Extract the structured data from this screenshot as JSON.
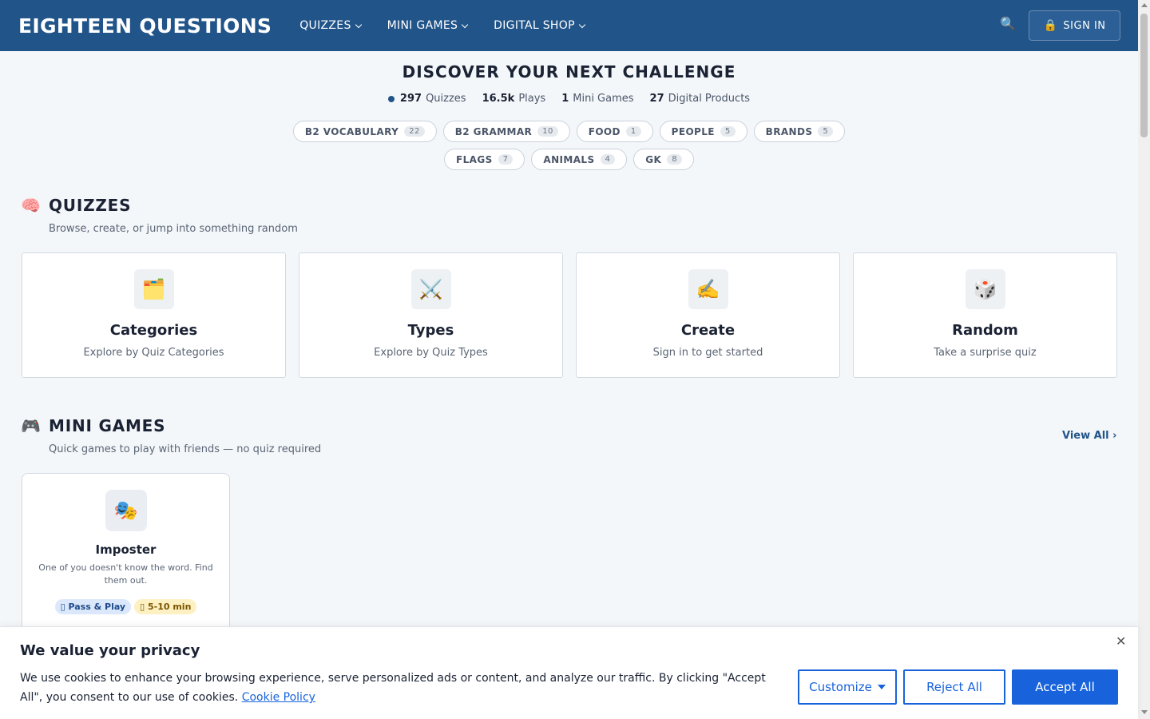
{
  "header": {
    "brand": "EIGHTEEN QUESTIONS",
    "nav": [
      {
        "label": "QUIZZES"
      },
      {
        "label": "MINI GAMES"
      },
      {
        "label": "DIGITAL SHOP"
      }
    ],
    "search_icon": "🔍",
    "signin_icon": "🔒",
    "signin_label": "SIGN IN"
  },
  "hero": {
    "title": "DISCOVER YOUR NEXT CHALLENGE",
    "stats": [
      {
        "value": "297",
        "label": "Quizzes"
      },
      {
        "value": "16.5k",
        "label": "Plays"
      },
      {
        "value": "1",
        "label": "Mini Games"
      },
      {
        "value": "27",
        "label": "Digital Products"
      }
    ],
    "chips": [
      {
        "label": "B2 VOCABULARY",
        "count": "22"
      },
      {
        "label": "B2 GRAMMAR",
        "count": "10"
      },
      {
        "label": "FOOD",
        "count": "1"
      },
      {
        "label": "PEOPLE",
        "count": "5"
      },
      {
        "label": "BRANDS",
        "count": "5"
      },
      {
        "label": "FLAGS",
        "count": "7"
      },
      {
        "label": "ANIMALS",
        "count": "4"
      },
      {
        "label": "GK",
        "count": "8"
      }
    ]
  },
  "quizzes": {
    "icon": "🧠",
    "title": "QUIZZES",
    "subtitle": "Browse, create, or jump into something random",
    "cards": [
      {
        "icon": "🗂️",
        "title": "Categories",
        "desc": "Explore by Quiz Categories"
      },
      {
        "icon": "⚔️",
        "title": "Types",
        "desc": "Explore by Quiz Types"
      },
      {
        "icon": "✍️",
        "title": "Create",
        "desc": "Sign in to get started"
      },
      {
        "icon": "🎲",
        "title": "Random",
        "desc": "Take a surprise quiz"
      }
    ]
  },
  "mini_games": {
    "icon": "🎮",
    "title": "MINI GAMES",
    "subtitle": "Quick games to play with friends — no quiz required",
    "view_all": "View All ›",
    "games": [
      {
        "icon": "🎭",
        "title": "Imposter",
        "desc": "One of you doesn't know the word. Find them out.",
        "tags": [
          "Pass & Play",
          "5-10 min"
        ]
      }
    ]
  },
  "cookie": {
    "title": "We value your privacy",
    "text": "We use cookies to enhance your browsing experience, serve personalized ads or content, and analyze our traffic. By clicking \"Accept All\", you consent to our use of cookies.",
    "link": "Cookie Policy",
    "close": "✕",
    "customize": "Customize",
    "reject": "Reject All",
    "accept": "Accept All"
  }
}
